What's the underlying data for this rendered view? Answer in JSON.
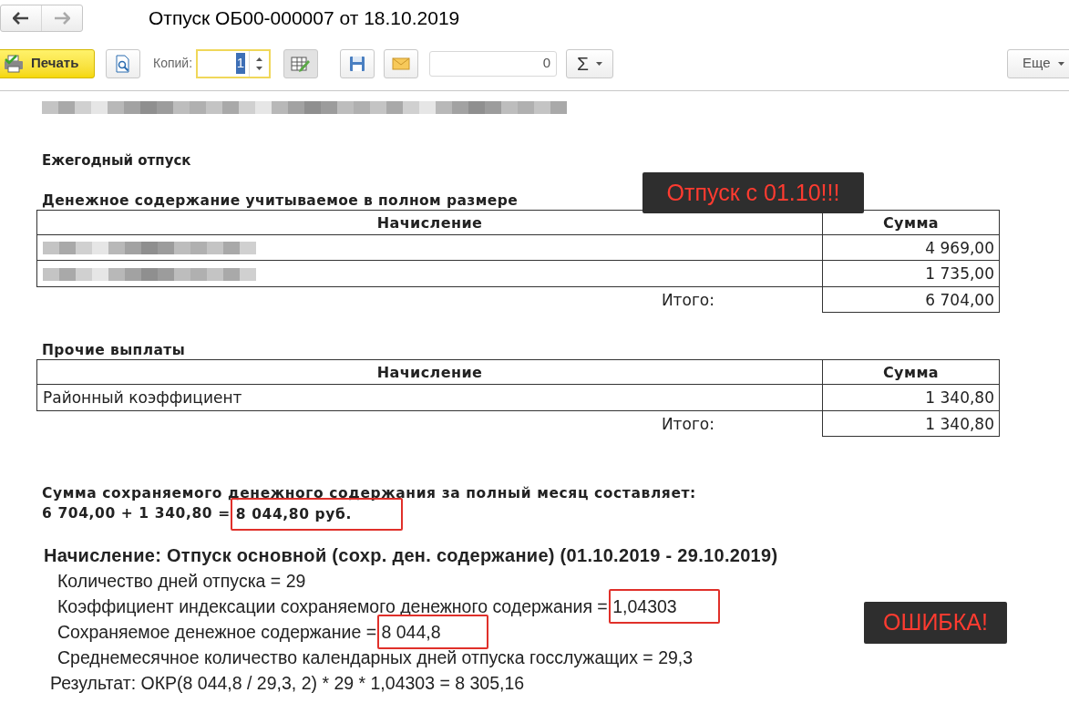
{
  "window": {
    "title": "Отпуск ОБ00-000007 от 18.10.2019"
  },
  "toolbar": {
    "print_button": "Печать",
    "copies_label": "Копий:",
    "copies_value": "1",
    "counter_value": "0",
    "sum_button": "Σ",
    "more_button": "Еще"
  },
  "document": {
    "redacted_header": true,
    "title": "Ежегодный отпуск",
    "sections": [
      {
        "heading": "Денежное содержание учитываемое в полном размере",
        "columns": [
          "Начисление",
          "Сумма"
        ],
        "rows": [
          {
            "kind": "redacted",
            "amount": "4 969,00"
          },
          {
            "kind": "redacted",
            "amount": "1 735,00"
          }
        ],
        "total_label": "Итого:",
        "total_value": "6 704,00"
      },
      {
        "heading": "Прочие выплаты",
        "columns": [
          "Начисление",
          "Сумма"
        ],
        "rows": [
          {
            "kind": "text",
            "name": "Районный коэффициент",
            "amount": "1 340,80"
          }
        ],
        "total_label": "Итого:",
        "total_value": "1 340,80"
      }
    ],
    "summary": {
      "text": "Сумма сохраняемого денежного содержания за полный месяц составляет:",
      "formula": "6 704,00 + 1 340,80 =",
      "value": "8 044,80 руб.",
      "highlighted": true
    },
    "calculation": {
      "heading": "Начисление: Отпуск основной (сохр. ден. содержание) (01.10.2019 - 29.10.2019)",
      "lines": [
        {
          "label": "Количество дней отпуска = ",
          "value": "29",
          "highlighted": false
        },
        {
          "label": "Коэффициент индексации сохраняемого денежного содержания = ",
          "value": "1,04303",
          "highlighted": true
        },
        {
          "label": "Сохраняемое денежное содержание = ",
          "value": "8 044,8",
          "highlighted": true
        },
        {
          "label": "Среднемесячное количество календарных дней отпуска госслужащих = ",
          "value": "29,3",
          "highlighted": false
        }
      ],
      "result": "Результат: ОКР(8 044,8 / 29,3, 2) * 29 * 1,04303 = 8 305,16"
    }
  },
  "callouts": [
    {
      "text": "Отпуск с 01.10!!!"
    },
    {
      "text": "ОШИБКА!"
    }
  ]
}
